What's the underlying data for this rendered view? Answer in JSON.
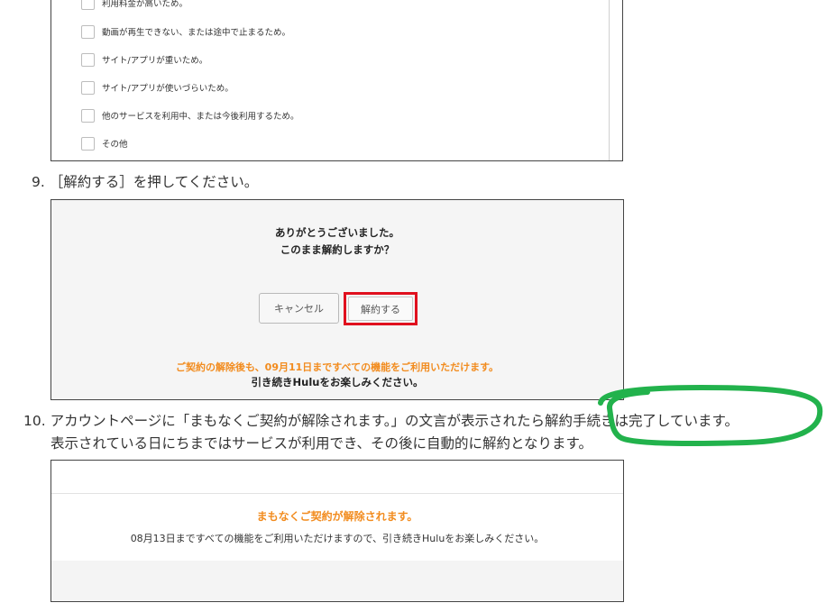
{
  "survey": {
    "options": [
      {
        "label": "利用料金が高いため。"
      },
      {
        "label": "動画が再生できない、または途中で止まるため。"
      },
      {
        "label": "サイト/アプリが重いため。"
      },
      {
        "label": "サイト/アプリが使いづらいため。"
      },
      {
        "label": "他のサービスを利用中、または今後利用するため。"
      },
      {
        "label": "その他"
      }
    ]
  },
  "steps": {
    "step9": {
      "number": "9.",
      "text": "［解約する］を押してください。"
    },
    "step10": {
      "number": "10.",
      "text_before": "アカウントページに「まもなくご契約が解除されます。」の文言が表示されたら",
      "text_highlight": "解約手続きは完了しています。",
      "line2": "表示されている日にちまではサービスが利用でき、その後に自動的に解約となります。"
    }
  },
  "confirm_dialog": {
    "line1": "ありがとうございました。",
    "line2": "このまま解約しますか？",
    "cancel_label": "キャンセル",
    "confirm_label": "解約する",
    "notice_orange": "ご契約の解除後も、09月11日まですべての機能をご利用いただけます。",
    "notice_dark": "引き続きHuluをお楽しみください。"
  },
  "account_page": {
    "title": "まもなくご契約が解除されます。",
    "description": "08月13日まですべての機能をご利用いただけますので、引き続きHuluをお楽しみください。"
  },
  "colors": {
    "accent_orange": "#f28c1f",
    "highlight_red": "#e0101e",
    "annotation_green": "#22b24c"
  },
  "icons": {
    "checkbox": "empty-checkbox-icon"
  }
}
